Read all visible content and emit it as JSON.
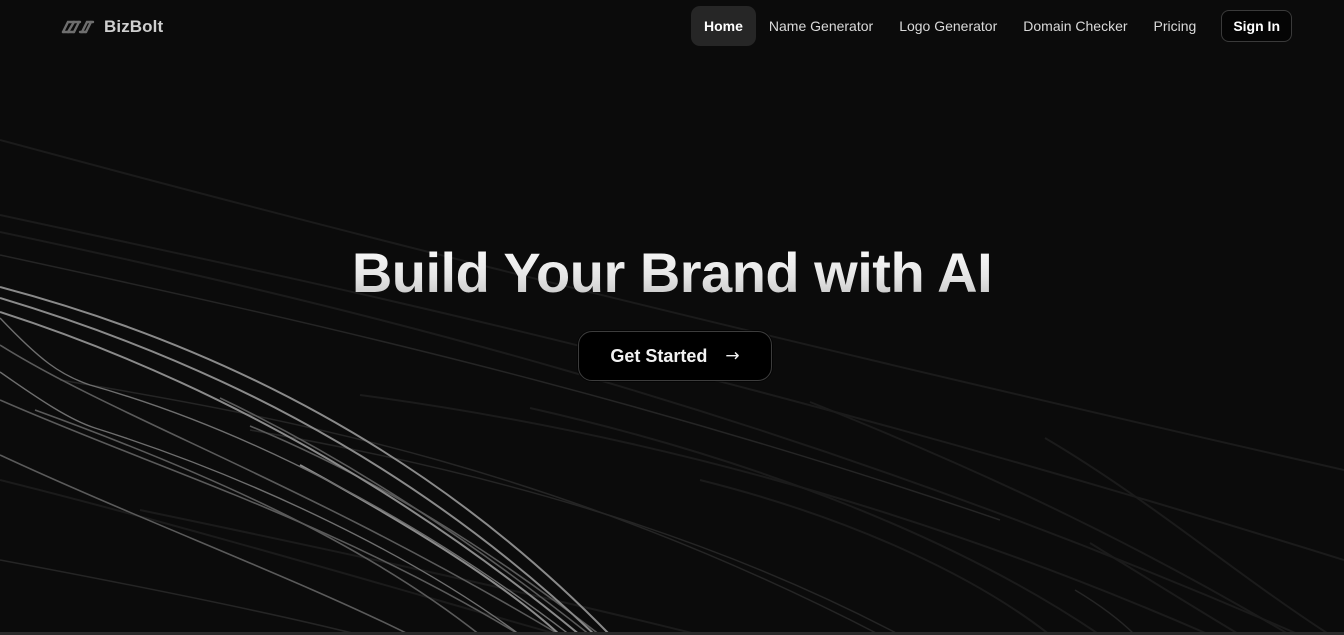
{
  "brand": {
    "name": "BizBolt",
    "icon": "chain-link-logo-icon"
  },
  "nav": {
    "items": [
      {
        "label": "Home",
        "active": true
      },
      {
        "label": "Name Generator",
        "active": false
      },
      {
        "label": "Logo Generator",
        "active": false
      },
      {
        "label": "Domain Checker",
        "active": false
      },
      {
        "label": "Pricing",
        "active": false
      }
    ],
    "sign_in_label": "Sign In"
  },
  "hero": {
    "title": "Build Your Brand with AI",
    "cta_label": "Get Started",
    "cta_icon": "arrow-right-icon"
  },
  "colors": {
    "background": "#0b0b0b",
    "active_nav_bg": "#262626",
    "text": "#e8e8e8"
  }
}
